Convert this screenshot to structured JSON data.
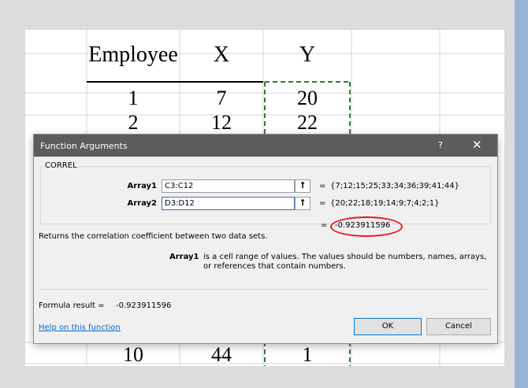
{
  "sheet": {
    "headers": [
      "Employee",
      "X",
      "Y"
    ],
    "rows_top": [
      [
        "1",
        "7",
        "20"
      ],
      [
        "2",
        "12",
        "22"
      ]
    ],
    "row_bottom": [
      "10",
      "44",
      "1"
    ]
  },
  "dialog": {
    "title": "Function Arguments",
    "help_glyph": "?",
    "close_glyph": "✕",
    "function_name": "CORREL",
    "args": [
      {
        "label": "Array1",
        "value": "C3:C12",
        "result": "{7;12;15;25;33;34;36;39;41;44}"
      },
      {
        "label": "Array2",
        "value": "D3:D12",
        "result": "{20;22;18;19;14;9;7;4;2;1}"
      }
    ],
    "ref_glyph": "⭡",
    "equals": "=",
    "overall_result": "-0.923911596",
    "description": "Returns the correlation coefficient between two data sets.",
    "arg_help_name": "Array1",
    "arg_help_text_1": "is a cell range of values. The values should be numbers, names, arrays,",
    "arg_help_text_2": "or references that contain numbers.",
    "formula_result_label": "Formula result =",
    "formula_result_value": "-0.923911596",
    "help_link": "Help on this function",
    "ok_label": "OK",
    "cancel_label": "Cancel"
  },
  "colors": {
    "titlebar": "#5c5c5c",
    "highlight_oval": "#e02020",
    "link": "#0066cc",
    "dashed_border": "#2e7d32"
  }
}
